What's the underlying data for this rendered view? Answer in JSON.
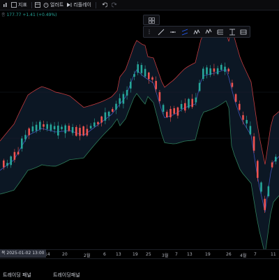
{
  "toolbar": {
    "indicators_label": "지표",
    "alerts_label": "얼러트",
    "replay_label": "리플레이"
  },
  "symbol_line": {
    "prefix": "종",
    "value": "177.77",
    "change": "+1.41 (+0.49%)"
  },
  "chart_data": {
    "type": "candlestick-bollinger",
    "x_axis_labels": [
      "2025-01-02",
      "13:00",
      "14",
      "20",
      "2월",
      "6",
      "13",
      "19",
      "25",
      "3월",
      "7",
      "13",
      "19",
      "26",
      "4월",
      "7",
      "11"
    ],
    "current_time_label": "목 2025-01-02  13:00",
    "colors": {
      "up": "#26a69a",
      "down": "#ef5350",
      "upper_band": "#c23b3f",
      "middle_band": "#3f51b5",
      "lower_band": "#2e7d5b",
      "band_fill": "#0e1b2a"
    }
  },
  "bottom": {
    "tabs": [
      "트레이딩 패널",
      "트레이딩패널"
    ]
  }
}
